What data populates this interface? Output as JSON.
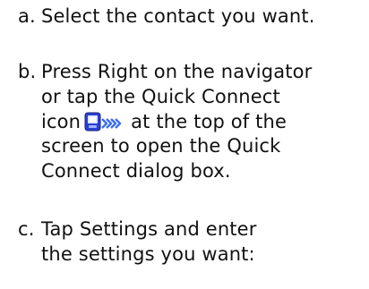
{
  "steps": [
    {
      "marker": "a.",
      "lines": [
        "Select the contact you want."
      ]
    },
    {
      "marker": "b.",
      "lines": [
        "Press Right on the navigator",
        "or tap the Quick Connect",
        "icon",
        "at the top of the",
        "screen to open the Quick",
        "Connect dialog box."
      ]
    },
    {
      "marker": "c.",
      "lines": [
        "Tap Settings and enter",
        "the settings you want:"
      ]
    }
  ],
  "icons": {
    "quick_connect": "quick-connect-icon"
  },
  "colors": {
    "text": "#111111",
    "icon_blue": "#2a3fd1",
    "icon_arrows": "#3b6ff0"
  }
}
